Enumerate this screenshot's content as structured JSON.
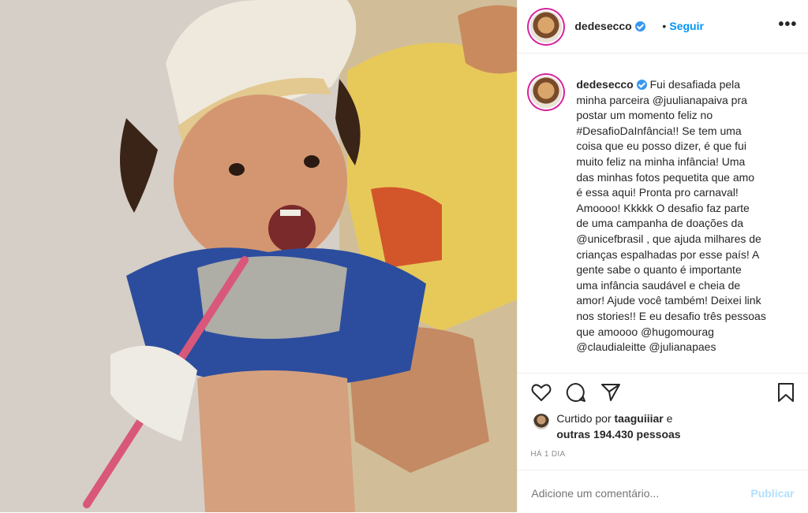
{
  "post": {
    "username": "dedesecco",
    "follow_label": "Seguir",
    "separator": "•",
    "more_label": "•••"
  },
  "caption": {
    "username": "dedesecco",
    "text": "Fui desafiada pela\nminha parceira @juulianapaiva pra\npostar um momento feliz no\n#DesafioDaInfância!! Se tem uma\ncoisa que eu posso dizer, é que fui\nmuito feliz na minha infância! Uma\ndas minhas fotos pequetita que amo\né essa aqui! Pronta pro carnaval!\nAmoooo! Kkkkk O desafio faz parte\nde uma campanha de doações da\n@unicefbrasil , que ajuda milhares de\ncrianças espalhadas por esse país! A\ngente sabe o quanto é importante\numa infância saudável e cheia de\namor! Ajude você também! Deixei link\nnos stories!! E eu desafio três pessoas\nque amoooo @hugomourag\n@claudialeitte @julianapaes"
  },
  "actions": {
    "icons": [
      "heart-icon",
      "comment-icon",
      "share-icon",
      "bookmark-icon"
    ]
  },
  "likes": {
    "prefix": "Curtido por",
    "user": "taaguiiiar",
    "suffix": "e",
    "others": "outras 194.430 pessoas"
  },
  "timestamp": "HÁ 1 DIA",
  "comment_box": {
    "placeholder": "Adicione um comentário...",
    "publish_label": "Publicar"
  },
  "colors": {
    "link": "#0095f6",
    "verified": "#3897f0",
    "publish_disabled": "#b2dffc",
    "muted": "#8e8e8e",
    "text": "#262626"
  }
}
